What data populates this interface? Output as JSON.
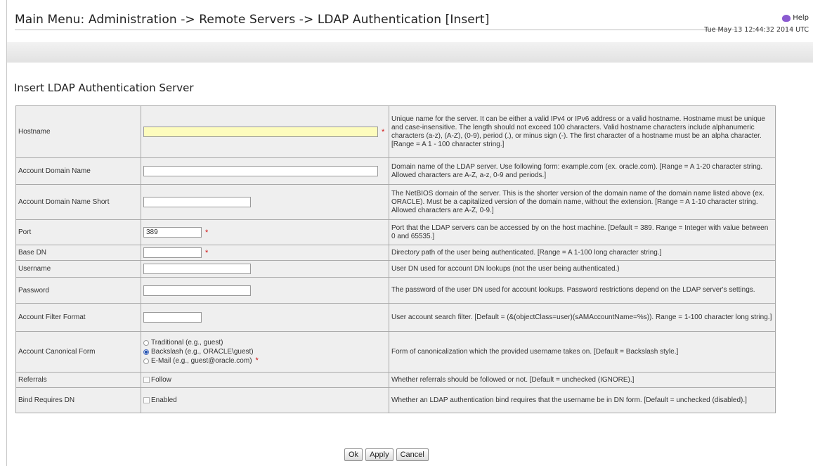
{
  "header": {
    "title": "Main Menu: Administration -> Remote Servers -> LDAP Authentication [Insert]",
    "help_label": "Help",
    "timestamp": "Tue May 13 12:44:32 2014 UTC"
  },
  "section": {
    "title": "Insert LDAP Authentication Server"
  },
  "form": {
    "rows": [
      {
        "label": "Hostname",
        "value": "",
        "required": "*",
        "description": "Unique name for the server. It can be either a valid IPv4 or IPv6 address or a valid hostname. Hostname must be unique and case-insensitive. The length should not exceed 100 characters. Valid hostname characters include alphanumeric characters (a-z), (A-Z), (0-9), period (.), or minus sign (-). The first character of a hostname must be an alpha character. [Range = A 1 - 100 character string.]"
      },
      {
        "label": "Account Domain Name",
        "value": "",
        "description": "Domain name of the LDAP server. Use following form: example.com (ex. oracle.com). [Range = A 1-20 character string. Allowed characters are A-Z, a-z, 0-9 and periods.]"
      },
      {
        "label": "Account Domain Name Short",
        "value": "",
        "description": "The NetBIOS domain of the server. This is the shorter version of the domain name of the domain name listed above (ex. ORACLE). Must be a capitalized version of the domain name, without the extension. [Range = A 1-10 character string. Allowed characters are A-Z, 0-9.]"
      },
      {
        "label": "Port",
        "value": "389",
        "required": "*",
        "description": "Port that the LDAP servers can be accessed by on the host machine. [Default = 389. Range = Integer with value between 0 and 65535.]"
      },
      {
        "label": "Base DN",
        "value": "",
        "required": "*",
        "description": "Directory path of the user being authenticated. [Range = A 1-100 long character string.]"
      },
      {
        "label": "Username",
        "value": "",
        "description": "User DN used for account DN lookups (not the user being authenticated.)"
      },
      {
        "label": "Password",
        "value": "",
        "description": "The password of the user DN used for account lookups. Password restrictions depend on the LDAP server's settings."
      },
      {
        "label": "Account Filter Format",
        "value": "",
        "description": "User account search filter. [Default = (&(objectClass=user)(sAMAccountName=%s)). Range = 1-100 character long string.]"
      },
      {
        "label": "Account Canonical Form",
        "options": [
          {
            "label": "Traditional (e.g., guest)",
            "selected": false
          },
          {
            "label": "Backslash (e.g., ORACLE\\guest)",
            "selected": true
          },
          {
            "label": "E-Mail (e.g., guest@oracle.com)",
            "selected": false
          }
        ],
        "required": "*",
        "description": "Form of canonicalization which the provided username takes on. [Default = Backslash style.]"
      },
      {
        "label": "Referrals",
        "checkbox_label": "Follow",
        "checked": false,
        "description": "Whether referrals should be followed or not. [Default = unchecked (IGNORE).]"
      },
      {
        "label": "Bind Requires DN",
        "checkbox_label": "Enabled",
        "checked": false,
        "description": "Whether an LDAP authentication bind requires that the username be in DN form. [Default = unchecked (disabled).]"
      }
    ]
  },
  "buttons": {
    "ok": "Ok",
    "apply": "Apply",
    "cancel": "Cancel"
  }
}
